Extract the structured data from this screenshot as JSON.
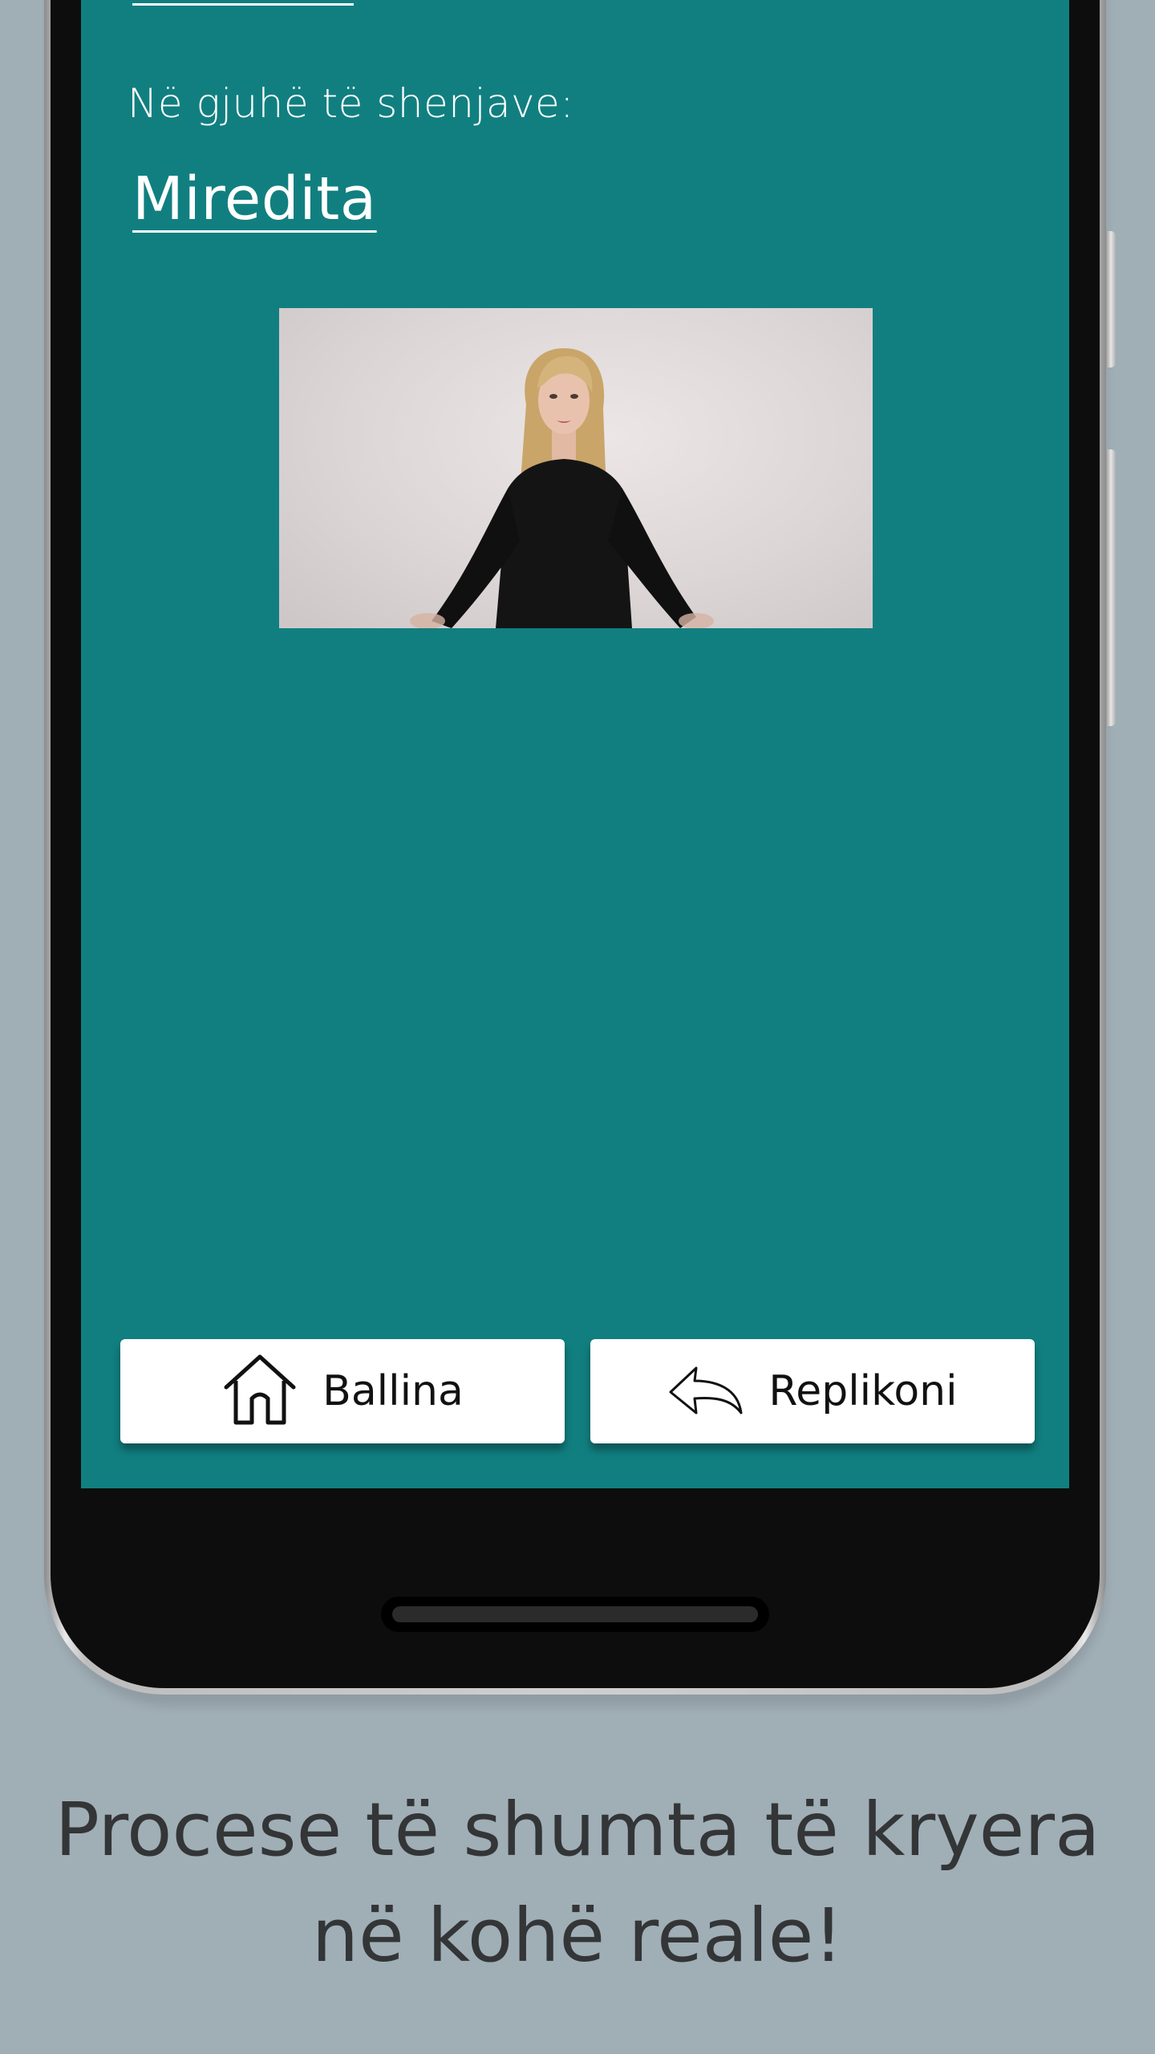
{
  "screen": {
    "sign_language_label": "Në gjuhë të shenjave:",
    "word": "Miredita",
    "video_alt": "Sign language video"
  },
  "buttons": {
    "home_label": "Ballina",
    "reply_label": "Replikoni"
  },
  "caption": {
    "line1": "Procese të shumta të kryera",
    "line2": "në kohë reale!"
  },
  "colors": {
    "screen_bg": "#117f80",
    "page_bg": "#a0aeb6",
    "button_bg": "#ffffff",
    "caption_text": "#333537"
  },
  "icons": {
    "home": "home-icon",
    "reply": "reply-icon"
  }
}
